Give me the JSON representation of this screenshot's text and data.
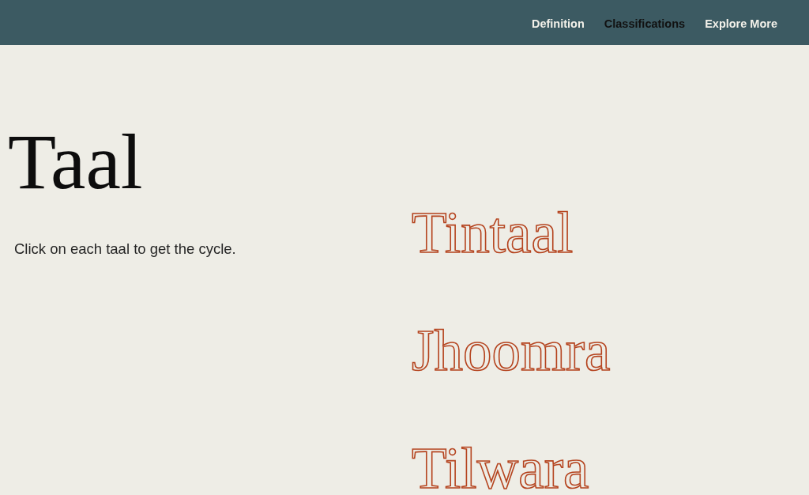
{
  "nav": {
    "links": [
      {
        "label": "Definition",
        "selected": false
      },
      {
        "label": "Classifications",
        "selected": true
      },
      {
        "label": "Explore More",
        "selected": false
      }
    ]
  },
  "intro": {
    "title": "Taal",
    "instruction": "Click on each taal to get the cycle."
  },
  "taals": [
    {
      "name": "Tintaal"
    },
    {
      "name": "Jhoomra"
    },
    {
      "name": "Tilwara"
    }
  ]
}
